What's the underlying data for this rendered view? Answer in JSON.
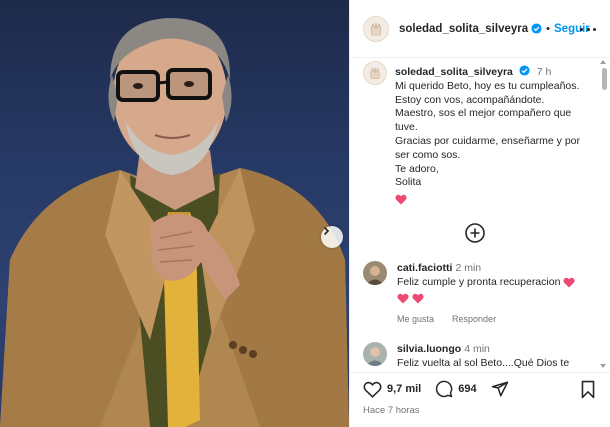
{
  "photo": {
    "alt_icon": "next-arrow-icon"
  },
  "header": {
    "username": "soledad_solita_silveyra",
    "separator": "•",
    "follow_label": "Seguir"
  },
  "caption": {
    "username": "soledad_solita_silveyra",
    "time": "7 h",
    "lines": [
      "Mi querido Beto, hoy es tu cumpleaños.",
      "Estoy con vos, acompañándote.",
      "Maestro, sos el mejor compañero que",
      "tuve.",
      "Gracias por cuidarme, enseñarme y por",
      "ser como sos.",
      "Te adoro,",
      "Solita"
    ]
  },
  "comments": [
    {
      "username": "cati.faciotti",
      "time": "2 min",
      "text": "Feliz cumple y pronta recuperacion",
      "like_label": "Me gusta",
      "reply_label": "Responder"
    },
    {
      "username": "silvia.luongo",
      "time": "4 min",
      "text": "Feliz vuelta al sol Beto....Qué Dios te"
    }
  ],
  "actions": {
    "likes": "9,7 mil",
    "comments": "694",
    "posted": "Hace 7 horas"
  },
  "colors": {
    "accent": "#0095f6",
    "verified": "#0095f6",
    "heart": "#ed4956",
    "muted": "#737373"
  }
}
